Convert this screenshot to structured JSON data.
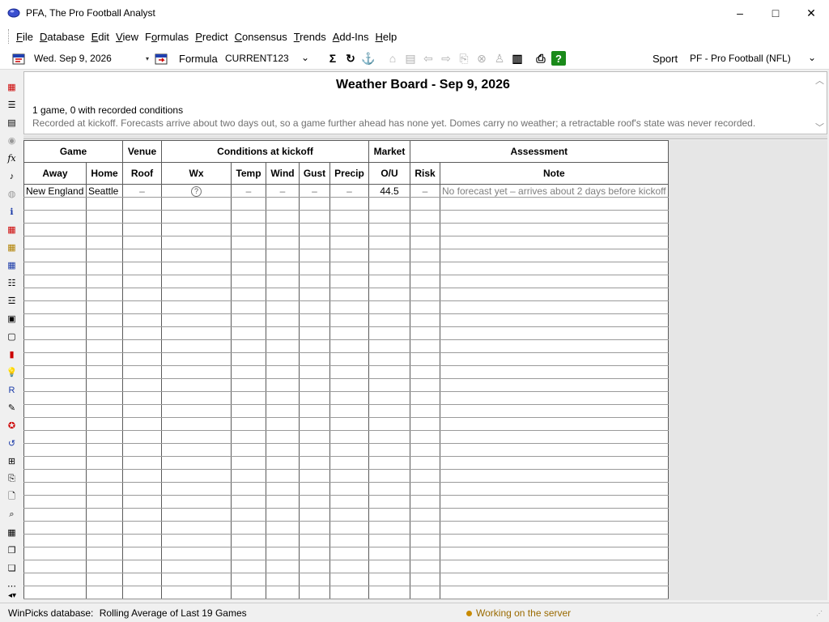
{
  "window": {
    "title": "PFA, The Pro Football Analyst",
    "min": "–",
    "max": "□",
    "close": "✕"
  },
  "menu": [
    {
      "label": "File",
      "key": "F"
    },
    {
      "label": "Database",
      "key": "D"
    },
    {
      "label": "Edit",
      "key": "E"
    },
    {
      "label": "View",
      "key": "V"
    },
    {
      "label": "Formulas",
      "key": "o"
    },
    {
      "label": "Predict",
      "key": "P"
    },
    {
      "label": "Consensus",
      "key": "C"
    },
    {
      "label": "Trends",
      "key": "T"
    },
    {
      "label": "Add-Ins",
      "key": "A"
    },
    {
      "label": "Help",
      "key": "H"
    }
  ],
  "toolbar": {
    "date": "Wed. Sep  9, 2026",
    "formula_label": "Formula",
    "formula_value": "CURRENT123",
    "sport_label": "Sport",
    "sport_value": "PF - Pro Football (NFL)"
  },
  "header": {
    "title": "Weather Board - Sep  9, 2026",
    "summary": "1 game, 0 with recorded conditions",
    "description": "Recorded at kickoff. Forecasts arrive about two days out, so a game further ahead has none yet. Domes carry no weather; a retractable roof's state was never recorded."
  },
  "grid": {
    "groups": [
      "Game",
      "Venue",
      "Conditions at kickoff",
      "Market",
      "Assessment"
    ],
    "columns": [
      "Away",
      "Home",
      "Roof",
      "Wx",
      "Temp",
      "Wind",
      "Gust",
      "Precip",
      "O/U",
      "Risk",
      "Note"
    ],
    "rows": [
      {
        "away": "New England",
        "home": "Seattle",
        "roof": "–",
        "wx": "?",
        "temp": "–",
        "wind": "–",
        "gust": "–",
        "precip": "–",
        "ou": "44.5",
        "risk": "–",
        "note": "No forecast yet – arrives about 2 days before kickoff"
      }
    ]
  },
  "status": {
    "database_label": "WinPicks database:",
    "database_value": "Rolling Average of Last 19 Games",
    "server": "Working on the server"
  }
}
